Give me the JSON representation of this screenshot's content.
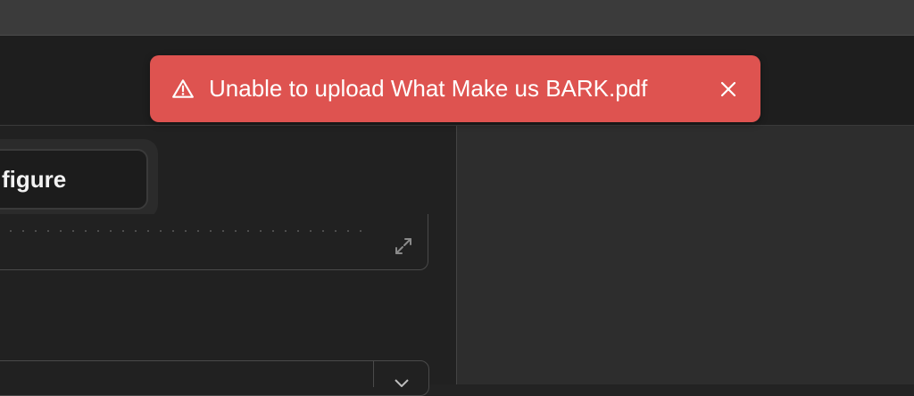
{
  "toast": {
    "message": "Unable to upload What Make us BARK.pdf",
    "color": "#de5350",
    "icon": "warning-triangle-icon",
    "close_icon": "close-icon"
  },
  "left_panel": {
    "configure_label": "figure",
    "textbox_icon": "expand-icon",
    "select_icon": "chevron-down-icon"
  }
}
